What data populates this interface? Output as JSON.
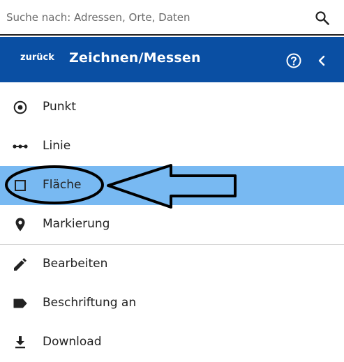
{
  "search": {
    "placeholder": "Suche nach: Adressen, Orte, Daten",
    "value": ""
  },
  "header": {
    "back_label": "zurück",
    "title": "Zeichnen/Messen"
  },
  "menu": {
    "draw_items": [
      {
        "label": "Punkt",
        "icon": "point-icon"
      },
      {
        "label": "Linie",
        "icon": "line-icon"
      },
      {
        "label": "Fläche",
        "icon": "polygon-icon",
        "selected": true
      },
      {
        "label": "Markierung",
        "icon": "marker-icon"
      }
    ],
    "tool_items": [
      {
        "label": "Bearbeiten",
        "icon": "pencil-icon"
      },
      {
        "label": "Beschriftung an",
        "icon": "label-tag-icon"
      },
      {
        "label": "Download",
        "icon": "download-icon"
      }
    ]
  },
  "colors": {
    "header_bg": "#0a4fa3",
    "selected_bg": "#78b9f2",
    "text": "#222222"
  }
}
